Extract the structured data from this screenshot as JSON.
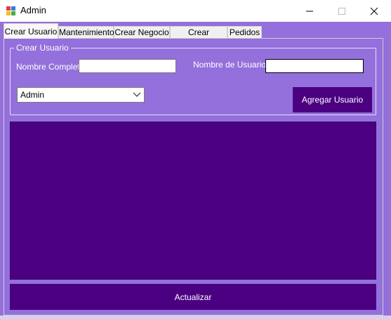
{
  "window": {
    "title": "Admin",
    "controls": {
      "minimize": "minimize-icon",
      "maximize": "maximize-icon",
      "close": "close-icon"
    }
  },
  "tabs": [
    {
      "label": "Crear Usuario",
      "active": true
    },
    {
      "label": "Mantenimiento",
      "active": false
    },
    {
      "label": "Crear Negocio",
      "active": false
    },
    {
      "label": "Crear Producto",
      "active": false
    },
    {
      "label": "Pedidos",
      "active": false
    }
  ],
  "form": {
    "group_label": "Crear Usuario",
    "nombre_completo_label": "Nombre Completo:",
    "nombre_completo_value": "",
    "nombre_usuario_label": "Nombre de Usuario:",
    "nombre_usuario_value": "",
    "role_selected": "Admin",
    "add_button": "Agregar Usuario"
  },
  "refresh_button": "Actualizar",
  "colors": {
    "background": "#9370DB",
    "accent_dark": "#4B0082",
    "text_light": "#ffffff"
  }
}
